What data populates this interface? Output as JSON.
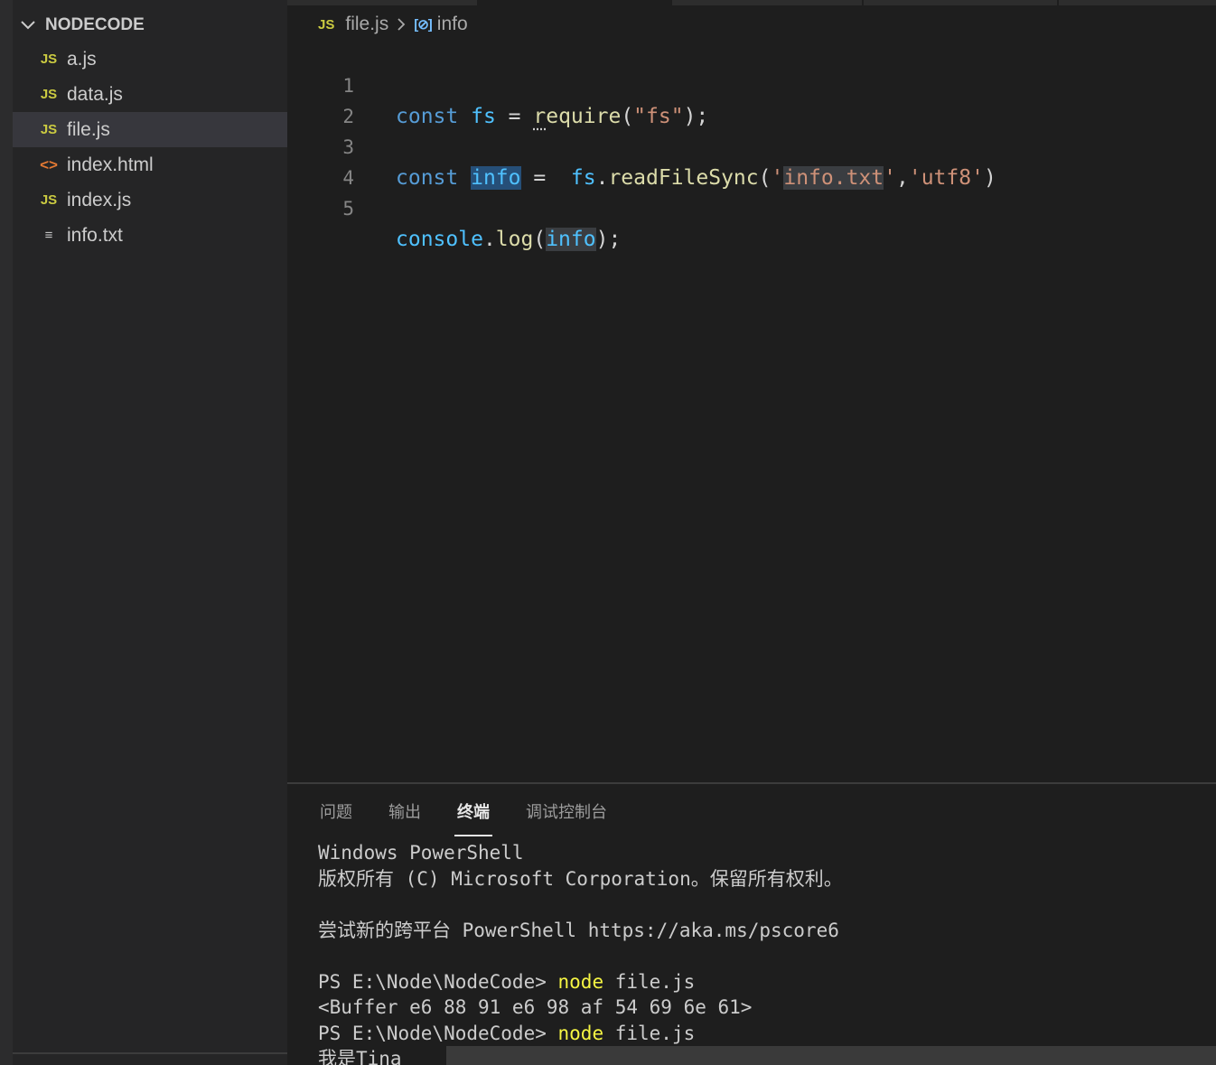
{
  "explorer": {
    "title": "NODECODE",
    "files": [
      {
        "name": "a.js",
        "icon": "JS",
        "kind": "js"
      },
      {
        "name": "data.js",
        "icon": "JS",
        "kind": "js"
      },
      {
        "name": "file.js",
        "icon": "JS",
        "kind": "js"
      },
      {
        "name": "index.html",
        "icon": "<>",
        "kind": "html"
      },
      {
        "name": "index.js",
        "icon": "JS",
        "kind": "js"
      },
      {
        "name": "info.txt",
        "icon": "≡",
        "kind": "txt"
      }
    ],
    "selected": "file.js"
  },
  "breadcrumb": {
    "file_icon": "JS",
    "file": "file.js",
    "symbol_icon": "[⊘]",
    "symbol": "info"
  },
  "code": {
    "line_numbers": [
      "1",
      "2",
      "3",
      "4",
      "5"
    ],
    "l1": {
      "kw": "const",
      "var": "fs",
      "eq": " = ",
      "fn_a": "r",
      "fn_b": "equire",
      "open": "(",
      "str": "\"fs\"",
      "close": ");"
    },
    "l3": {
      "kw": "const",
      "var": "info",
      "eq": " =  ",
      "obj": "fs",
      "dot": ".",
      "fn": "readFileSync",
      "open": "(",
      "q1": "'",
      "str1": "info.txt",
      "q2": "'",
      "comma": ",",
      "str2": "'utf8'",
      "close": ")"
    },
    "l5": {
      "obj": "console",
      "dot": ".",
      "fn": "log",
      "open": "(",
      "arg": "info",
      "close": ");"
    }
  },
  "panel": {
    "tabs": [
      "问题",
      "输出",
      "终端",
      "调试控制台"
    ],
    "active_tab": "终端",
    "terminal": {
      "line1": "Windows PowerShell",
      "line2": "版权所有 (C) Microsoft Corporation。保留所有权利。",
      "line3": "",
      "line4": "尝试新的跨平台 PowerShell https://aka.ms/pscore6",
      "line5": "",
      "prompt1": "PS E:\\Node\\NodeCode> ",
      "cmd1": "node",
      "arg1": " file.js",
      "line7": "<Buffer e6 88 91 e6 98 af 54 69 6e 61>",
      "prompt2": "PS E:\\Node\\NodeCode> ",
      "cmd2": "node",
      "arg2": " file.js",
      "line9": "我是Tina"
    }
  },
  "colors": {
    "js_icon": "#cbcb41",
    "html_icon": "#e37933",
    "keyword": "#569cd6",
    "variable": "#4fc1ff",
    "function": "#dcdcaa",
    "string": "#ce9178",
    "selection": "#264f78",
    "terminal_command": "#f5f543"
  }
}
